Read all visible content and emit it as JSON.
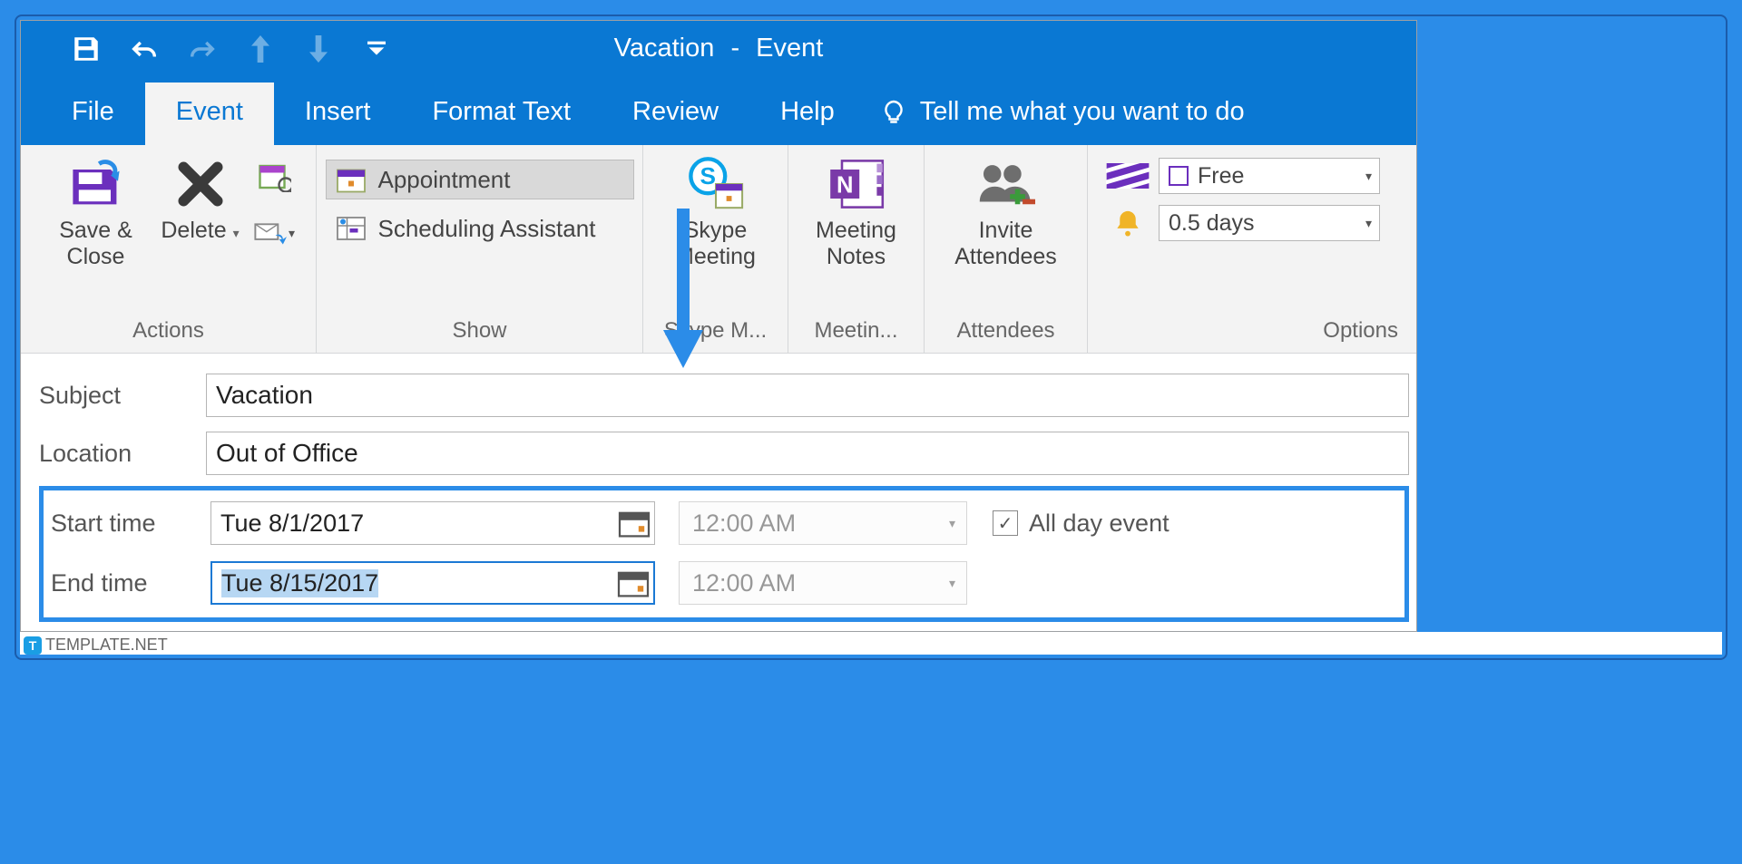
{
  "title": {
    "item": "Vacation",
    "type": "Event"
  },
  "tabs": {
    "file": "File",
    "event": "Event",
    "insert": "Insert",
    "format": "Format Text",
    "review": "Review",
    "help": "Help",
    "tellme": "Tell me what you want to do"
  },
  "ribbon": {
    "actions": {
      "label": "Actions",
      "save_close": "Save & Close",
      "delete": "Delete"
    },
    "show": {
      "label": "Show",
      "appointment": "Appointment",
      "scheduling": "Scheduling Assistant"
    },
    "skype": {
      "label": "Skype M...",
      "btn": "Skype Meeting"
    },
    "meeting_notes": {
      "label": "Meetin...",
      "btn": "Meeting Notes"
    },
    "attendees": {
      "label": "Attendees",
      "btn": "Invite Attendees"
    },
    "options": {
      "label": "Options",
      "show_as": "Free",
      "reminder": "0.5 days"
    }
  },
  "form": {
    "subject_label": "Subject",
    "subject_value": "Vacation",
    "location_label": "Location",
    "location_value": "Out of Office",
    "start_label": "Start time",
    "start_date": "Tue 8/1/2017",
    "start_time": "12:00 AM",
    "end_label": "End time",
    "end_date": "Tue 8/15/2017",
    "end_time": "12:00 AM",
    "allday_label": "All day event",
    "allday_checked": true
  },
  "watermark": "TEMPLATE.NET"
}
